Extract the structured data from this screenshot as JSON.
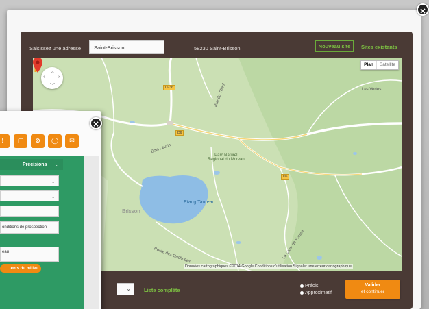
{
  "address_form": {
    "label": "Saisissez une adresse",
    "value": "Saint-Brisson",
    "result": "58230 Saint-Brisson"
  },
  "header_actions": {
    "new_site": "Nouveau site",
    "existing_sites": "Sites existants"
  },
  "map": {
    "type_active": "Plan",
    "type_inactive": "Satellite",
    "lake_label": "Etang Taureau",
    "park_label": "Parc Naturel\nRégional du Morvan",
    "places": [
      "Les Vertes",
      "Bois Leurin",
      "La Croix de Frasse",
      "Rue du Tilleul",
      "Route des Ouchottes",
      "Brisson"
    ],
    "road_shields": [
      "D236",
      "D6",
      "D6"
    ],
    "footer": "Données cartographiques ©2014 Google   Conditions d'utilisation   Signaler une erreur cartographique"
  },
  "bottom": {
    "link_complete": "Liste complète",
    "radio_options": [
      "Précis",
      "Approximatif"
    ],
    "validate_line1": "Valider",
    "validate_line2": "et continuer"
  },
  "panel": {
    "precisions": "Précisions",
    "field_conditions": "onditions de prospection",
    "field_eau": "eau",
    "pill": "ents du milieu"
  },
  "colors": {
    "frame_brown": "#4a3a35",
    "accent_green": "#7dc142",
    "accent_orange": "#f08a12",
    "panel_green": "#2e9a64"
  }
}
